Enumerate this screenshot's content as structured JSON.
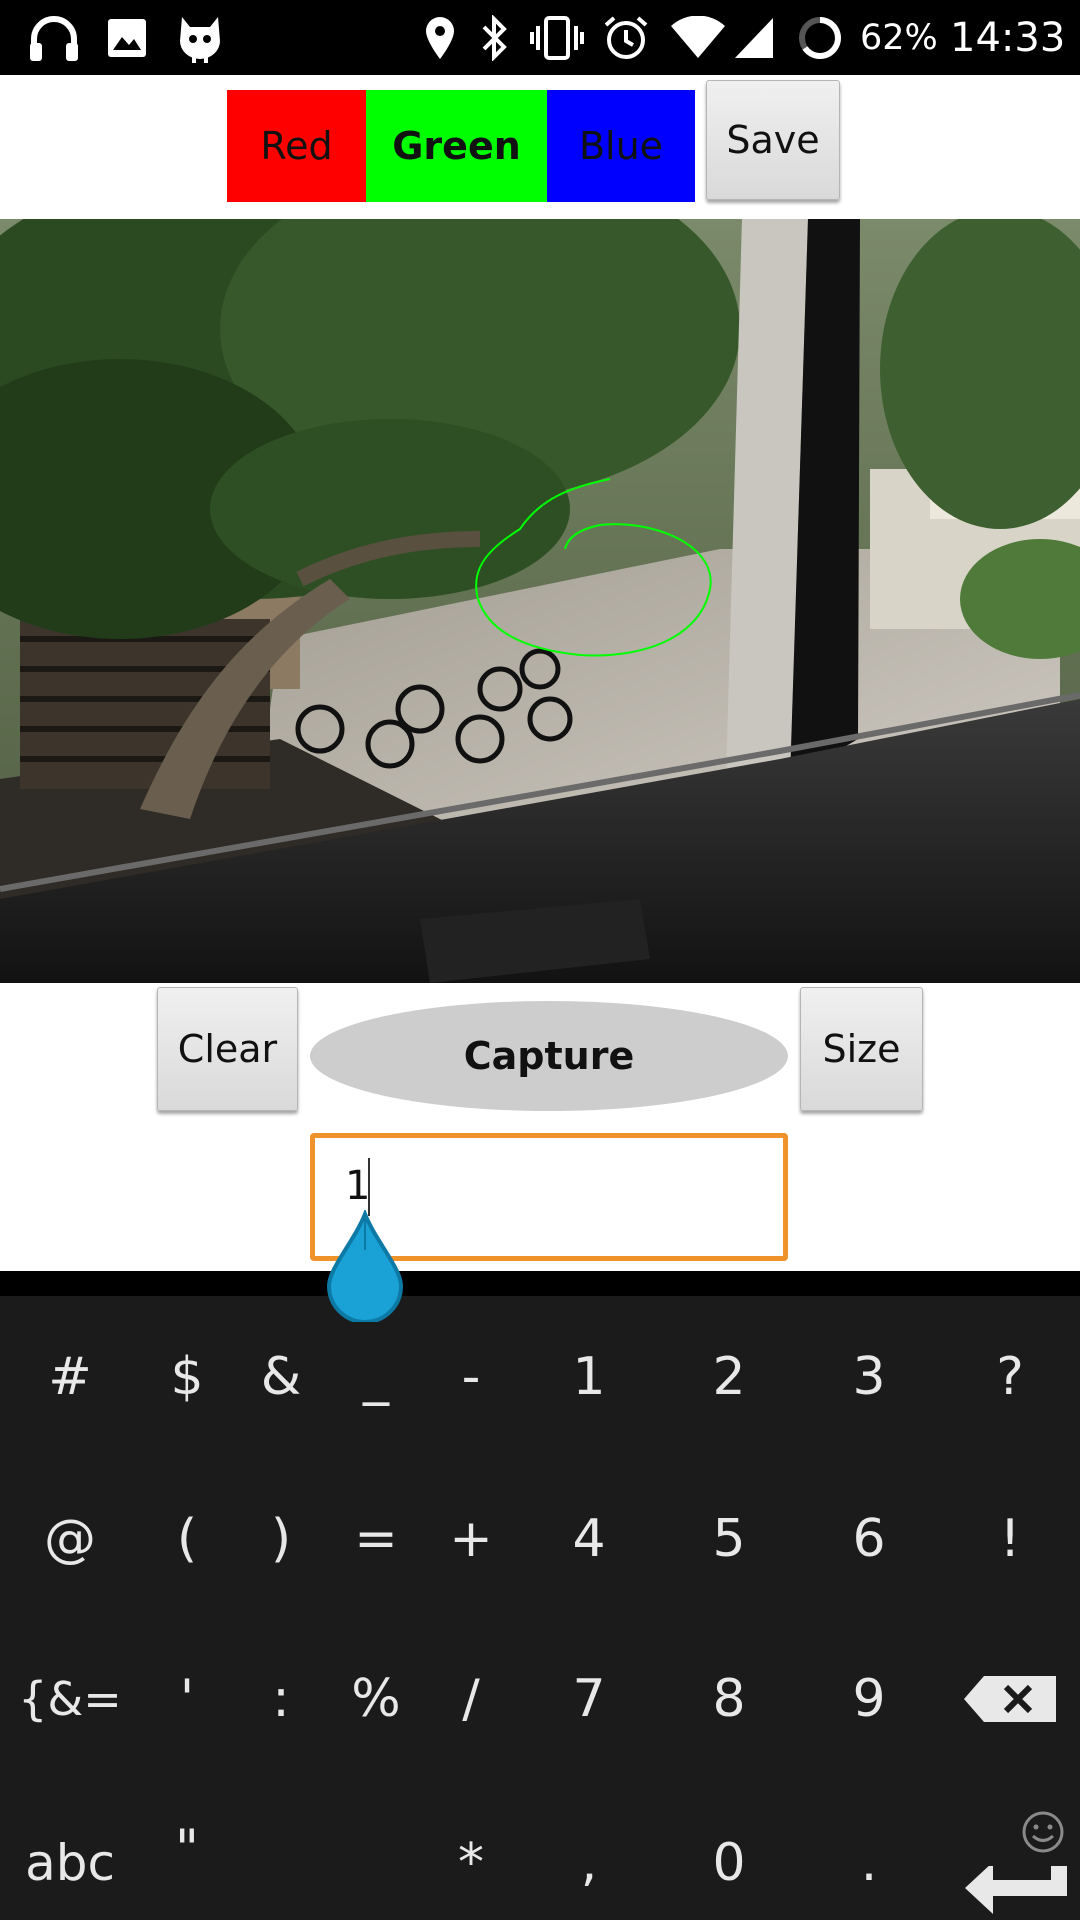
{
  "status_bar": {
    "battery": "62%",
    "time": "14:33",
    "icons": [
      "headphones-icon",
      "image-icon",
      "cyanogen-icon",
      "location-icon",
      "bluetooth-icon",
      "vibrate-icon",
      "alarm-icon",
      "wifi-icon",
      "signal-icon",
      "battery-ring-icon"
    ]
  },
  "toolbar": {
    "red_label": "Red",
    "green_label": "Green",
    "blue_label": "Blue",
    "save_label": "Save",
    "selected_color": "Green",
    "colors": {
      "red": "#ff0000",
      "green": "#00ff00",
      "blue": "#0000ff"
    }
  },
  "canvas": {
    "stroke_color": "#00ff00"
  },
  "controls": {
    "clear_label": "Clear",
    "capture_label": "Capture",
    "size_label": "Size",
    "size_value": "1"
  },
  "keyboard": {
    "rows": [
      [
        "#",
        "$",
        "&",
        "_",
        "-",
        "1",
        "2",
        "3",
        "?"
      ],
      [
        "@",
        "(",
        ")",
        "=",
        "+",
        "4",
        "5",
        "6",
        "!"
      ],
      [
        "{&=",
        "'",
        ":",
        "%",
        "/",
        "7",
        "8",
        "9"
      ],
      [
        "abc",
        "\"",
        "*",
        ",",
        "0",
        "."
      ]
    ]
  }
}
